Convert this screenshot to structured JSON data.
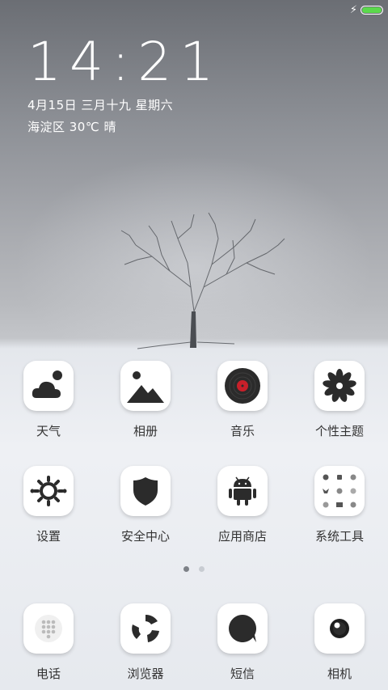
{
  "status": {
    "battery_level": 1.0,
    "charging": true,
    "battery_color": "#5bd94c"
  },
  "lockinfo": {
    "time": "14:21",
    "date": "4月15日 三月十九 星期六",
    "weather": "海淀区 30℃ 晴"
  },
  "apps_row1": [
    {
      "label": "天气",
      "icon": "weather-icon"
    },
    {
      "label": "相册",
      "icon": "gallery-icon"
    },
    {
      "label": "音乐",
      "icon": "music-icon"
    },
    {
      "label": "个性主题",
      "icon": "theme-icon"
    }
  ],
  "apps_row2": [
    {
      "label": "设置",
      "icon": "settings-icon"
    },
    {
      "label": "安全中心",
      "icon": "security-icon"
    },
    {
      "label": "应用商店",
      "icon": "app-store-icon"
    },
    {
      "label": "系统工具",
      "icon": "tools-folder-icon"
    }
  ],
  "pager": {
    "pages": 2,
    "current": 1
  },
  "dock": [
    {
      "label": "电话",
      "icon": "phone-icon"
    },
    {
      "label": "浏览器",
      "icon": "browser-icon"
    },
    {
      "label": "短信",
      "icon": "messages-icon"
    },
    {
      "label": "相机",
      "icon": "camera-icon"
    }
  ],
  "colors": {
    "accent_music": "#c8202a",
    "label_text": "#333333"
  }
}
